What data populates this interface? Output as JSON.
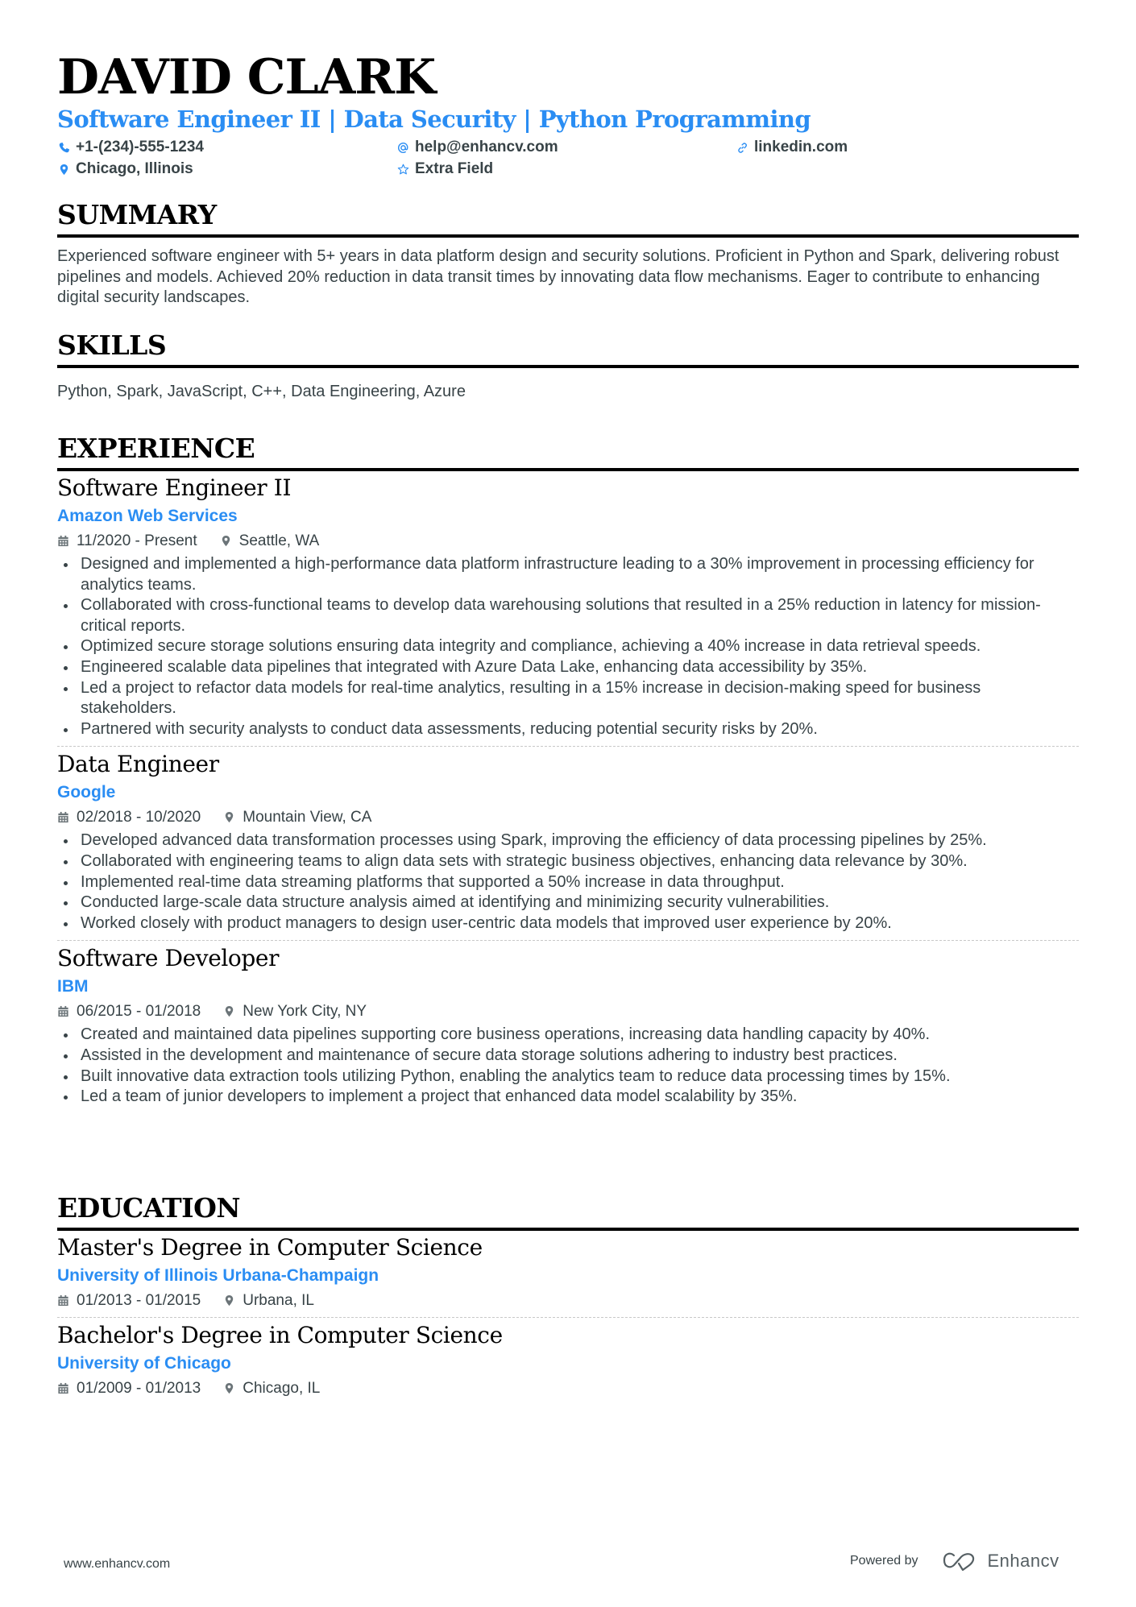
{
  "header": {
    "name": "DAVID CLARK",
    "headline": "Software Engineer II | Data Security | Python Programming",
    "contacts": {
      "phone": {
        "icon": "phone-icon",
        "value": "+1-(234)-555-1234"
      },
      "email": {
        "icon": "at-icon",
        "value": "help@enhancv.com"
      },
      "linkedin": {
        "icon": "link-icon",
        "value": "linkedin.com"
      },
      "location": {
        "icon": "location-pin-icon",
        "value": "Chicago, Illinois"
      },
      "extra": {
        "icon": "star-icon",
        "value": "Extra Field"
      }
    }
  },
  "colors": {
    "accent": "#2a8df3",
    "text": "#384347",
    "heading": "#000000"
  },
  "summary": {
    "title": "SUMMARY",
    "text": "Experienced software engineer with 5+ years in data platform design and security solutions. Proficient in Python and Spark, delivering robust pipelines and models. Achieved 20% reduction in data transit times by innovating data flow mechanisms. Eager to contribute to enhancing digital security landscapes."
  },
  "skills": {
    "title": "SKILLS",
    "text": "Python, Spark, JavaScript, C++, Data Engineering, Azure"
  },
  "experience": {
    "title": "EXPERIENCE",
    "jobs": [
      {
        "title": "Software Engineer II",
        "company": "Amazon Web Services",
        "dates": "11/2020 - Present",
        "location": "Seattle, WA",
        "bullets": [
          "Designed and implemented a high-performance data platform infrastructure leading to a 30% improvement in processing efficiency for analytics teams.",
          "Collaborated with cross-functional teams to develop data warehousing solutions that resulted in a 25% reduction in latency for mission-critical reports.",
          "Optimized secure storage solutions ensuring data integrity and compliance, achieving a 40% increase in data retrieval speeds.",
          "Engineered scalable data pipelines that integrated with Azure Data Lake, enhancing data accessibility by 35%.",
          "Led a project to refactor data models for real-time analytics, resulting in a 15% increase in decision-making speed for business stakeholders.",
          "Partnered with security analysts to conduct data assessments, reducing potential security risks by 20%."
        ]
      },
      {
        "title": "Data Engineer",
        "company": "Google",
        "dates": "02/2018 - 10/2020",
        "location": "Mountain View, CA",
        "bullets": [
          "Developed advanced data transformation processes using Spark, improving the efficiency of data processing pipelines by 25%.",
          "Collaborated with engineering teams to align data sets with strategic business objectives, enhancing data relevance by 30%.",
          "Implemented real-time data streaming platforms that supported a 50% increase in data throughput.",
          "Conducted large-scale data structure analysis aimed at identifying and minimizing security vulnerabilities.",
          "Worked closely with product managers to design user-centric data models that improved user experience by 20%."
        ]
      },
      {
        "title": "Software Developer",
        "company": "IBM",
        "dates": "06/2015 - 01/2018",
        "location": "New York City, NY",
        "bullets": [
          "Created and maintained data pipelines supporting core business operations, increasing data handling capacity by 40%.",
          "Assisted in the development and maintenance of secure data storage solutions adhering to industry best practices.",
          "Built innovative data extraction tools utilizing Python, enabling the analytics team to reduce data processing times by 15%.",
          "Led a team of junior developers to implement a project that enhanced data model scalability by 35%."
        ]
      }
    ]
  },
  "education": {
    "title": "EDUCATION",
    "items": [
      {
        "degree": "Master's Degree in Computer Science",
        "school": "University of Illinois Urbana-Champaign",
        "dates": "01/2013 - 01/2015",
        "location": "Urbana, IL"
      },
      {
        "degree": "Bachelor's Degree in Computer Science",
        "school": "University of Chicago",
        "dates": "01/2009 - 01/2013",
        "location": "Chicago, IL"
      }
    ]
  },
  "footer": {
    "website": "www.enhancv.com",
    "powered_by": "Powered by",
    "brand": "Enhancv",
    "brand_icon": "enhancv-logo-icon"
  }
}
